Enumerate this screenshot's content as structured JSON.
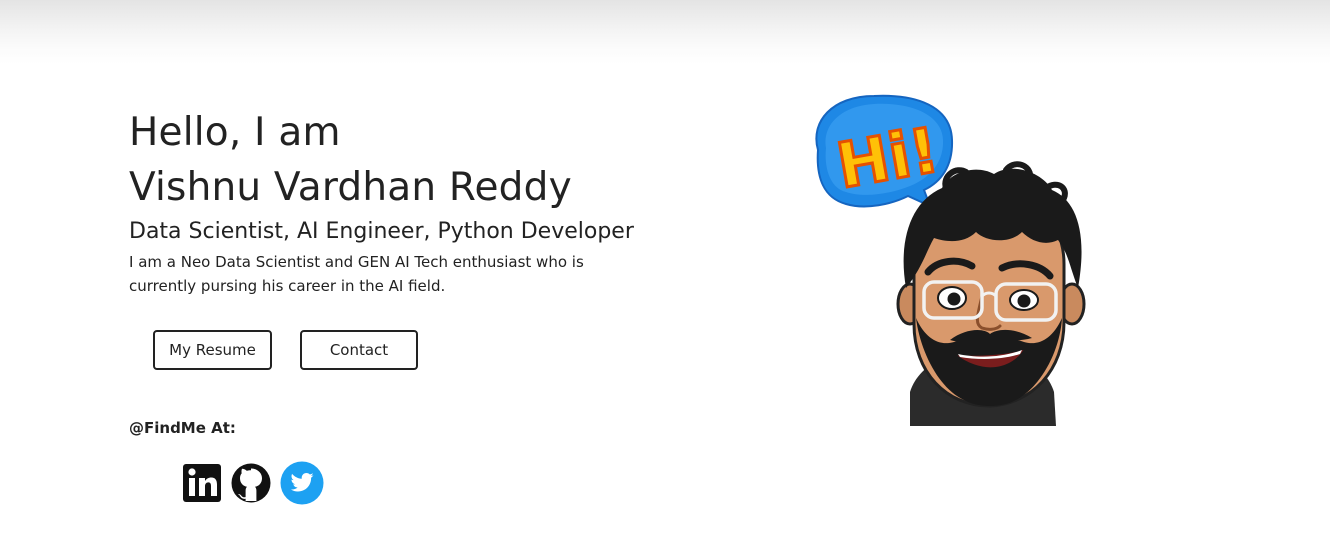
{
  "hero": {
    "greeting": "Hello, I am",
    "name": "Vishnu Vardhan Reddy",
    "roles": "Data Scientist, AI Engineer, Python Developer",
    "bio": "I am a Neo Data Scientist and GEN AI Tech enthusiast who is currently pursing his career in the AI field."
  },
  "buttons": {
    "resume_label": "My Resume",
    "contact_label": "Contact"
  },
  "findme": {
    "label": "@FindMe At:",
    "socials": [
      {
        "icon": "linkedin-icon"
      },
      {
        "icon": "github-icon"
      },
      {
        "icon": "twitter-icon"
      }
    ]
  },
  "avatar": {
    "icon": "bitmoji-avatar-hi",
    "speech_bubble_text": "Hi!"
  },
  "colors": {
    "text": "#222222",
    "twitter_blue": "#1da1f2",
    "bubble_blue": "#1e88e5",
    "bubble_yellow": "#ffc107"
  }
}
